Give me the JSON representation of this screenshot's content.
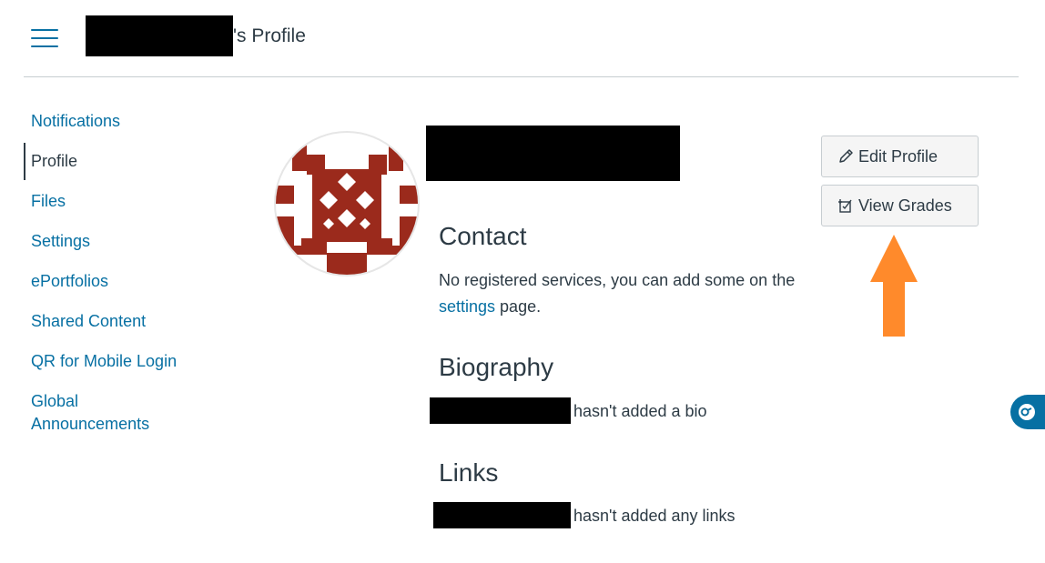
{
  "header": {
    "title_suffix": "'s Profile"
  },
  "nav": {
    "items": [
      {
        "label": "Notifications",
        "active": false
      },
      {
        "label": "Profile",
        "active": true
      },
      {
        "label": "Files",
        "active": false
      },
      {
        "label": "Settings",
        "active": false
      },
      {
        "label": "ePortfolios",
        "active": false
      },
      {
        "label": "Shared Content",
        "active": false
      },
      {
        "label": "QR for Mobile Login",
        "active": false
      },
      {
        "label": "Global Announcements",
        "active": false
      }
    ]
  },
  "actions": {
    "edit_profile": "Edit Profile",
    "view_grades": "View Grades"
  },
  "contact": {
    "heading": "Contact",
    "text_before": "No registered services, you can add some on the ",
    "link": "settings",
    "text_after": " page."
  },
  "biography": {
    "heading": "Biography",
    "text": "hasn't added a bio"
  },
  "links": {
    "heading": "Links",
    "text": "hasn't added any links"
  },
  "colors": {
    "link": "#0770a3",
    "text": "#2d3b45",
    "avatar": "#9b2a1c",
    "arrow": "#ff8a2b"
  },
  "icons": {
    "menu": "hamburger-icon",
    "edit": "pencil-icon",
    "grades": "grades-icon",
    "annotation": "up-arrow",
    "widget": "chat-icon"
  }
}
